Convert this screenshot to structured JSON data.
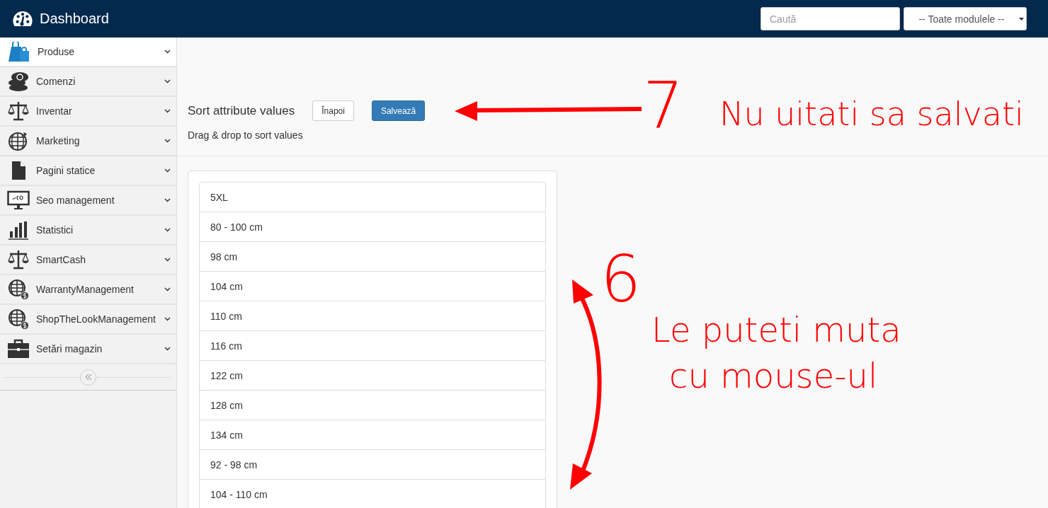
{
  "header": {
    "title": "Dashboard",
    "search": {
      "placeholder": "Caută"
    },
    "module_select": {
      "value": "-- Toate modulele --"
    }
  },
  "sidebar": {
    "items": [
      {
        "label": "Produse",
        "selected": true
      },
      {
        "label": "Comenzi",
        "selected": false
      },
      {
        "label": "Inventar",
        "selected": false
      },
      {
        "label": "Marketing",
        "selected": false
      },
      {
        "label": "Pagini statice",
        "selected": false
      },
      {
        "label": "Seo management",
        "selected": false
      },
      {
        "label": "Statistici",
        "selected": false
      },
      {
        "label": "SmartCash",
        "selected": false
      },
      {
        "label": "WarrantyManagement",
        "selected": false
      },
      {
        "label": "ShopTheLookManagement",
        "selected": false
      },
      {
        "label": "Setări magazin",
        "selected": false
      }
    ]
  },
  "page": {
    "title": "Sort attribute values",
    "back_button": "Înapoi",
    "save_button": "Salvează",
    "subtitle": "Drag & drop to sort values",
    "values": [
      "5XL",
      "80 - 100 cm",
      "98 cm",
      "104 cm",
      "110 cm",
      "116 cm",
      "122 cm",
      "128 cm",
      "134 cm",
      "92 - 98 cm",
      "104 - 110 cm"
    ]
  },
  "annotations": [
    {
      "kind": "number",
      "text": "7"
    },
    {
      "kind": "note",
      "text": "Nu uitati sa salvati"
    },
    {
      "kind": "number",
      "text": "6"
    },
    {
      "kind": "note",
      "text": "Le puteti muta"
    },
    {
      "kind": "note",
      "text": "cu mouse-ul"
    }
  ]
}
